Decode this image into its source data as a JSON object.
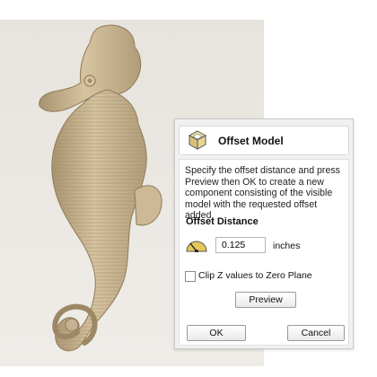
{
  "dialog": {
    "title": "Offset Model",
    "icon": "offset-model-icon",
    "description": "Specify the offset distance and press Preview then OK to create a new component consisting of the visible model with the requested offset added.",
    "section_title": "Offset Distance",
    "offset_value": "0.125",
    "units": "inches",
    "clip_label": "Clip Z values to Zero Plane",
    "clip_checked": false,
    "preview_label": "Preview",
    "ok_label": "OK",
    "cancel_label": "Cancel"
  },
  "viewport": {
    "model": "seahorse relief",
    "model_color": "#c6b190",
    "background_color": "#e9e5df"
  }
}
